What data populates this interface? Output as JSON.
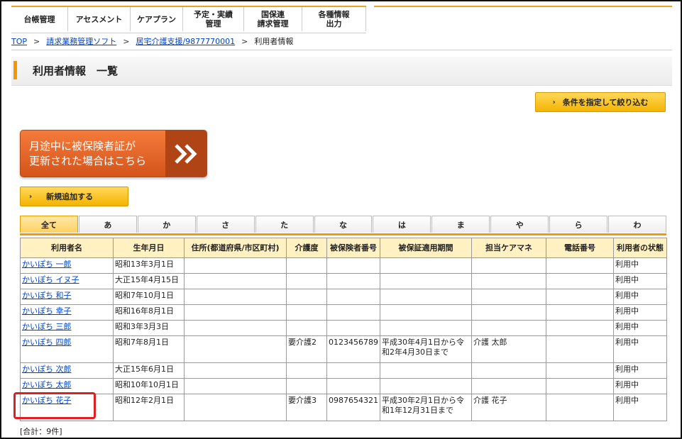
{
  "nav": [
    {
      "label": "台帳管理"
    },
    {
      "label": "アセスメント"
    },
    {
      "label": "ケアプラン"
    },
    {
      "label": "予定・実績\n管理"
    },
    {
      "label": "国保連\n請求管理"
    },
    {
      "label": "各種情報\n出力"
    }
  ],
  "breadcrumb": {
    "top": "TOP",
    "sep": ">",
    "item1": "請求業務管理ソフト",
    "item2": "居宅介護支援/9877770001",
    "current": "利用者情報"
  },
  "page_title": "利用者情報　一覧",
  "filter_button": "条件を指定して絞り込む",
  "arrow": "›",
  "banner": {
    "text": "月途中に被保険者証が\n更新された場合はこちら",
    "chevron": "»"
  },
  "add_button": "新規追加する",
  "tabs": [
    "全て",
    "あ",
    "か",
    "さ",
    "た",
    "な",
    "は",
    "ま",
    "や",
    "ら",
    "わ"
  ],
  "table": {
    "headers": [
      "利用者名",
      "生年月日",
      "住所(都道府県/市区町村)",
      "介護度",
      "被保険者番号",
      "被保証適用期間",
      "担当ケアマネ",
      "電話番号",
      "利用者の状態"
    ],
    "rows": [
      [
        "かいぽち 一郎",
        "昭和13年3月1日",
        "",
        "",
        "",
        "",
        "",
        "",
        "利用中"
      ],
      [
        "かいぽち イヌ子",
        "大正15年4月15日",
        "",
        "",
        "",
        "",
        "",
        "",
        "利用中"
      ],
      [
        "かいぽち 和子",
        "昭和7年10月1日",
        "",
        "",
        "",
        "",
        "",
        "",
        "利用中"
      ],
      [
        "かいぽち 幸子",
        "昭和16年8月1日",
        "",
        "",
        "",
        "",
        "",
        "",
        "利用中"
      ],
      [
        "かいぽち 三郎",
        "昭和3年3月3日",
        "",
        "",
        "",
        "",
        "",
        "",
        "利用中"
      ],
      [
        "かいぽち 四郎",
        "昭和7年8月1日",
        "",
        "要介護2",
        "0123456789",
        "平成30年4月1日から令和2年4月30日まで",
        "介護 太郎",
        "",
        "利用中"
      ],
      [
        "かいぽち 次郎",
        "大正15年6月1日",
        "",
        "",
        "",
        "",
        "",
        "",
        "利用中"
      ],
      [
        "かいぽち 太郎",
        "昭和10年10月1日",
        "",
        "",
        "",
        "",
        "",
        "",
        "利用中"
      ],
      [
        "かいぽち 花子",
        "昭和12年2月1日",
        "",
        "要介護3",
        "0987654321",
        "平成30年2月1日から令和1年12月31日まで",
        "介護 花子",
        "",
        "利用中"
      ]
    ]
  },
  "total": "[合計：9件]",
  "colors": {
    "accent": "#f39800",
    "link": "#0044cc",
    "highlight": "#e02020"
  }
}
